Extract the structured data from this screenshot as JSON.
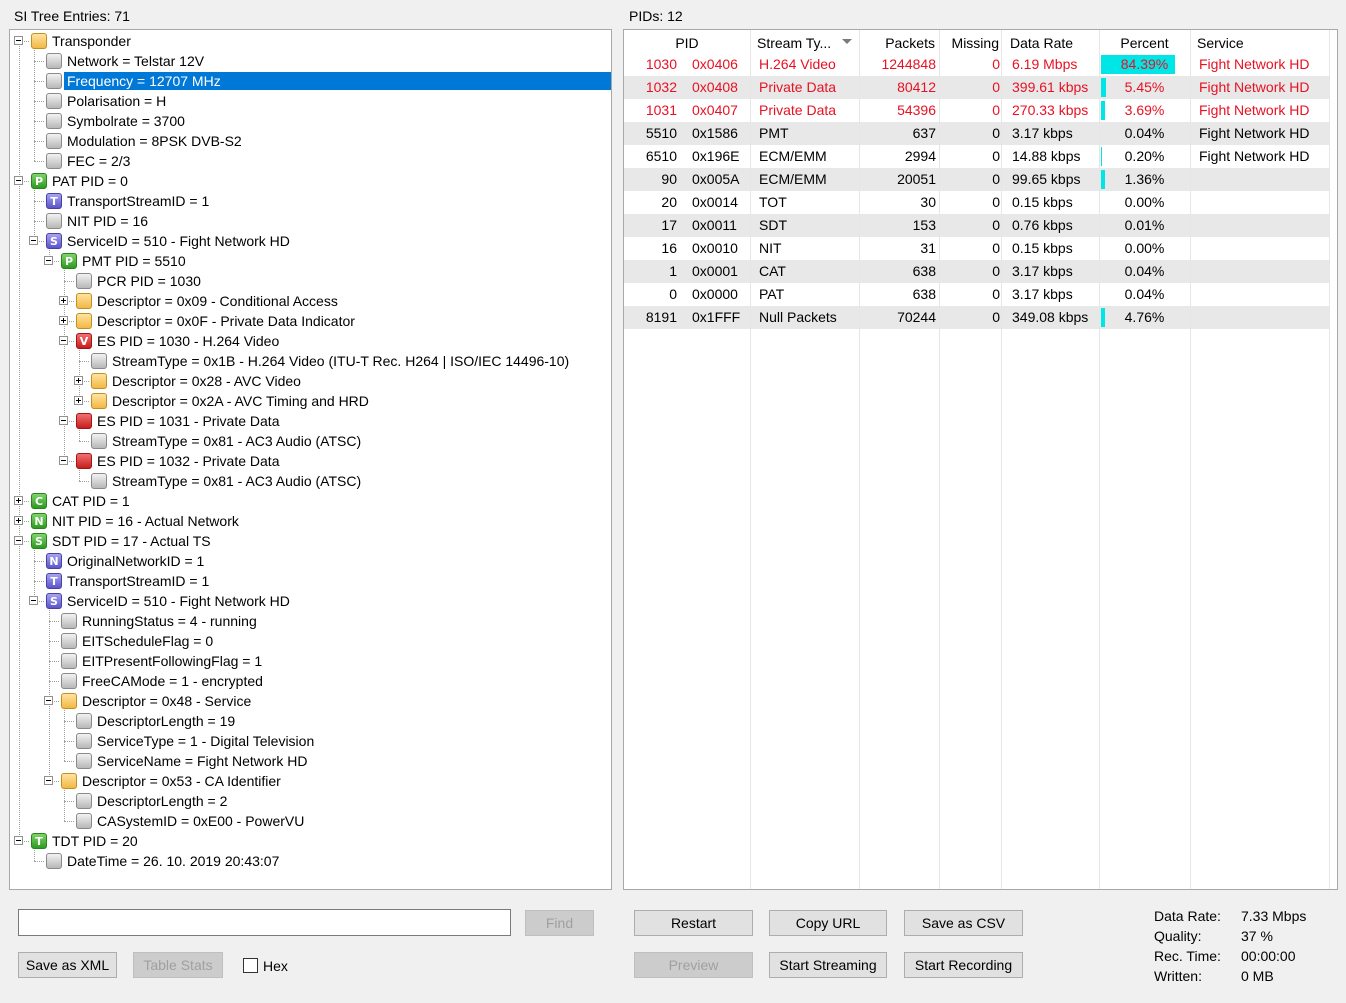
{
  "left_caption": "SI Tree Entries: 71",
  "right_caption": "PIDs: 12",
  "tree": [
    {
      "label": "Transponder",
      "icon": "folder",
      "level": 0,
      "expander": "minus"
    },
    {
      "label": "Network = Telstar 12V",
      "icon": "leaf",
      "level": 1
    },
    {
      "label": "Frequency = 12707 MHz",
      "icon": "leaf",
      "level": 1,
      "selected": true
    },
    {
      "label": "Polarisation = H",
      "icon": "leaf",
      "level": 1
    },
    {
      "label": "Symbolrate = 3700",
      "icon": "leaf",
      "level": 1
    },
    {
      "label": "Modulation = 8PSK DVB-S2",
      "icon": "leaf",
      "level": 1
    },
    {
      "label": "FEC = 2/3",
      "icon": "leaf",
      "level": 1
    },
    {
      "label": "PAT PID = 0",
      "icon": "P",
      "level": 0,
      "expander": "minus"
    },
    {
      "label": "TransportStreamID = 1",
      "icon": "T-svc",
      "level": 1
    },
    {
      "label": "NIT PID = 16",
      "icon": "leaf",
      "level": 1
    },
    {
      "label": "ServiceID = 510 - Fight Network HD",
      "icon": "S-svc",
      "level": 1,
      "expander": "minus"
    },
    {
      "label": "PMT PID = 5510",
      "icon": "P",
      "level": 2,
      "expander": "minus"
    },
    {
      "label": "PCR PID = 1030",
      "icon": "leaf",
      "level": 3
    },
    {
      "label": "Descriptor = 0x09 - Conditional Access",
      "icon": "folder",
      "level": 3,
      "expander": "plus"
    },
    {
      "label": "Descriptor = 0x0F - Private Data Indicator",
      "icon": "folder",
      "level": 3,
      "expander": "plus"
    },
    {
      "label": "ES PID = 1030 - H.264 Video",
      "icon": "V",
      "level": 3,
      "expander": "minus"
    },
    {
      "label": "StreamType = 0x1B - H.264 Video (ITU-T Rec. H264 | ISO/IEC 14496-10)",
      "icon": "leaf",
      "level": 4
    },
    {
      "label": "Descriptor = 0x28 - AVC Video",
      "icon": "folder",
      "level": 4,
      "expander": "plus"
    },
    {
      "label": "Descriptor = 0x2A - AVC Timing and HRD",
      "icon": "folder",
      "level": 4,
      "expander": "plus"
    },
    {
      "label": "ES PID = 1031 - Private Data",
      "icon": "red",
      "level": 3,
      "expander": "minus"
    },
    {
      "label": "StreamType = 0x81 - AC3 Audio (ATSC)",
      "icon": "leaf",
      "level": 4
    },
    {
      "label": "ES PID = 1032 - Private Data",
      "icon": "red",
      "level": 3,
      "expander": "minus"
    },
    {
      "label": "StreamType = 0x81 - AC3 Audio (ATSC)",
      "icon": "leaf",
      "level": 4
    },
    {
      "label": "CAT PID = 1",
      "icon": "C",
      "level": 0,
      "expander": "plus"
    },
    {
      "label": "NIT PID = 16 - Actual Network",
      "icon": "N",
      "level": 0,
      "expander": "plus"
    },
    {
      "label": "SDT PID = 17 - Actual TS",
      "icon": "S",
      "level": 0,
      "expander": "minus"
    },
    {
      "label": "OriginalNetworkID = 1",
      "icon": "N-svc",
      "level": 1
    },
    {
      "label": "TransportStreamID = 1",
      "icon": "T-svc",
      "level": 1
    },
    {
      "label": "ServiceID = 510 - Fight Network HD",
      "icon": "S-svc",
      "level": 1,
      "expander": "minus"
    },
    {
      "label": "RunningStatus = 4 - running",
      "icon": "leaf",
      "level": 2
    },
    {
      "label": "EITScheduleFlag = 0",
      "icon": "leaf",
      "level": 2
    },
    {
      "label": "EITPresentFollowingFlag = 1",
      "icon": "leaf",
      "level": 2
    },
    {
      "label": "FreeCAMode = 1 - encrypted",
      "icon": "leaf",
      "level": 2
    },
    {
      "label": "Descriptor = 0x48 - Service",
      "icon": "folder",
      "level": 2,
      "expander": "minus"
    },
    {
      "label": "DescriptorLength = 19",
      "icon": "leaf",
      "level": 3
    },
    {
      "label": "ServiceType = 1 - Digital Television",
      "icon": "leaf",
      "level": 3
    },
    {
      "label": "ServiceName = Fight Network HD",
      "icon": "leaf",
      "level": 3
    },
    {
      "label": "Descriptor = 0x53 - CA Identifier",
      "icon": "folder",
      "level": 2,
      "expander": "minus"
    },
    {
      "label": "DescriptorLength = 2",
      "icon": "leaf",
      "level": 3
    },
    {
      "label": "CASystemID = 0xE00 - PowerVU",
      "icon": "leaf",
      "level": 3
    },
    {
      "label": "TDT PID = 20",
      "icon": "T",
      "level": 0,
      "expander": "minus"
    },
    {
      "label": "DateTime = 26. 10. 2019 20:43:07",
      "icon": "leaf",
      "level": 1
    }
  ],
  "pid_table": {
    "headers": [
      "PID",
      "Stream Ty...",
      "Packets",
      "Missing",
      "Data Rate",
      "Percent",
      "Service"
    ],
    "sort_icon": "sort-desc-icon",
    "rows": [
      {
        "pid": "1030",
        "hex": "0x0406",
        "type": "H.264 Video",
        "packets": "1244848",
        "missing": "0",
        "rate": "6.19 Mbps",
        "percent": "84.39%",
        "pct": 84.39,
        "service": "Fight Network HD",
        "red": true
      },
      {
        "pid": "1032",
        "hex": "0x0408",
        "type": "Private Data",
        "packets": "80412",
        "missing": "0",
        "rate": "399.61 kbps",
        "percent": "5.45%",
        "pct": 5.45,
        "service": "Fight Network HD",
        "red": true
      },
      {
        "pid": "1031",
        "hex": "0x0407",
        "type": "Private Data",
        "packets": "54396",
        "missing": "0",
        "rate": "270.33 kbps",
        "percent": "3.69%",
        "pct": 3.69,
        "service": "Fight Network HD",
        "red": true
      },
      {
        "pid": "5510",
        "hex": "0x1586",
        "type": "PMT",
        "packets": "637",
        "missing": "0",
        "rate": "3.17 kbps",
        "percent": "0.04%",
        "pct": 0.04,
        "service": "Fight Network HD",
        "red": false
      },
      {
        "pid": "6510",
        "hex": "0x196E",
        "type": "ECM/EMM",
        "packets": "2994",
        "missing": "0",
        "rate": "14.88 kbps",
        "percent": "0.20%",
        "pct": 0.2,
        "service": "Fight Network HD",
        "red": false
      },
      {
        "pid": "90",
        "hex": "0x005A",
        "type": "ECM/EMM",
        "packets": "20051",
        "missing": "0",
        "rate": "99.65 kbps",
        "percent": "1.36%",
        "pct": 1.36,
        "service": "",
        "red": false
      },
      {
        "pid": "20",
        "hex": "0x0014",
        "type": "TOT",
        "packets": "30",
        "missing": "0",
        "rate": "0.15 kbps",
        "percent": "0.00%",
        "pct": 0,
        "service": "",
        "red": false
      },
      {
        "pid": "17",
        "hex": "0x0011",
        "type": "SDT",
        "packets": "153",
        "missing": "0",
        "rate": "0.76 kbps",
        "percent": "0.01%",
        "pct": 0.01,
        "service": "",
        "red": false
      },
      {
        "pid": "16",
        "hex": "0x0010",
        "type": "NIT",
        "packets": "31",
        "missing": "0",
        "rate": "0.15 kbps",
        "percent": "0.00%",
        "pct": 0,
        "service": "",
        "red": false
      },
      {
        "pid": "1",
        "hex": "0x0001",
        "type": "CAT",
        "packets": "638",
        "missing": "0",
        "rate": "3.17 kbps",
        "percent": "0.04%",
        "pct": 0.04,
        "service": "",
        "red": false
      },
      {
        "pid": "0",
        "hex": "0x0000",
        "type": "PAT",
        "packets": "638",
        "missing": "0",
        "rate": "3.17 kbps",
        "percent": "0.04%",
        "pct": 0.04,
        "service": "",
        "red": false
      },
      {
        "pid": "8191",
        "hex": "0x1FFF",
        "type": "Null Packets",
        "packets": "70244",
        "missing": "0",
        "rate": "349.08 kbps",
        "percent": "4.76%",
        "pct": 4.76,
        "service": "",
        "red": false
      }
    ]
  },
  "controls": {
    "find_value": "",
    "find_label": "Find",
    "save_xml_label": "Save as XML",
    "table_stats_label": "Table Stats",
    "hex_label": "Hex",
    "restart_label": "Restart",
    "copy_url_label": "Copy URL",
    "save_csv_label": "Save as CSV",
    "preview_label": "Preview",
    "start_streaming_label": "Start Streaming",
    "start_recording_label": "Start Recording"
  },
  "stats": {
    "data_rate_label": "Data Rate:",
    "data_rate_value": "7.33 Mbps",
    "quality_label": "Quality:",
    "quality_value": "37 %",
    "rec_time_label": "Rec. Time:",
    "rec_time_value": "00:00:00",
    "written_label": "Written:",
    "written_value": "0 MB"
  },
  "colors": {
    "selection": "#0078d7",
    "highlight_red": "#e81123",
    "percent_bar": "#00e5e5"
  }
}
